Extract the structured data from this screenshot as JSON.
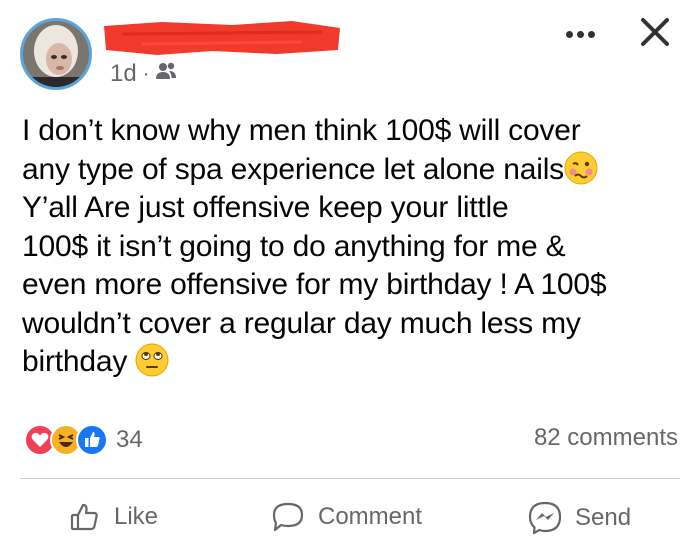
{
  "post": {
    "time": "1d",
    "separator": "·",
    "audience_icon": "friends-icon",
    "text_lines": [
      "I don’t know why men think 100$ will cover",
      "any type of spa experience let alone nails",
      "Y’all Are just offensive keep your little",
      "100$ it isn’t going to do anything for me &",
      "even more offensive for my birthday ! A 100$",
      "wouldn’t cover a regular day much less my",
      "birthday"
    ]
  },
  "reactions": {
    "icons": [
      "love-icon",
      "haha-icon",
      "like-icon"
    ],
    "count": "34"
  },
  "comments_count": "82 comments",
  "actions": {
    "like": "Like",
    "comment": "Comment",
    "send": "Send"
  },
  "colors": {
    "redaction": "#f03a2c",
    "avatar_ring": "#5aa6d8",
    "secondary_text": "#65676b"
  }
}
